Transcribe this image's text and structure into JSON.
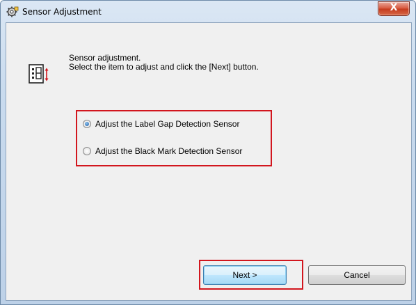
{
  "window": {
    "title": "Sensor Adjustment",
    "close_label": "X"
  },
  "instruction": {
    "line1": "Sensor adjustment.",
    "line2": "Select the item to adjust and click the [Next] button."
  },
  "options": [
    {
      "label": "Adjust the Label Gap Detection Sensor",
      "selected": true
    },
    {
      "label": "Adjust the Black Mark Detection Sensor",
      "selected": false
    }
  ],
  "buttons": {
    "next_label": "Next >",
    "cancel_label": "Cancel"
  },
  "colors": {
    "highlight_box": "#d2161e",
    "dialog_background": "#f0f0f0"
  }
}
